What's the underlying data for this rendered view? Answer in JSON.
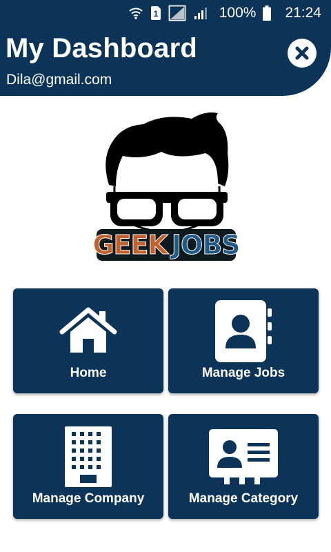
{
  "status_bar": {
    "sim_slot": "1",
    "battery": "100%",
    "time": "21:24"
  },
  "header": {
    "title": "My Dashboard",
    "email": "Dila@gmail.com"
  },
  "logo": {
    "word1": "GEEK",
    "word2": "JOBS"
  },
  "tiles": [
    {
      "label": "Home",
      "icon": "home-icon"
    },
    {
      "label": "Manage Jobs",
      "icon": "contact-book-icon"
    },
    {
      "label": "Manage Company",
      "icon": "building-icon"
    },
    {
      "label": "Manage Category",
      "icon": "id-card-icon"
    }
  ],
  "colors": {
    "primary": "#0c3458",
    "background": "#ffffff",
    "logo_geek": "#c4602a",
    "logo_jobs": "#1f5a86"
  }
}
